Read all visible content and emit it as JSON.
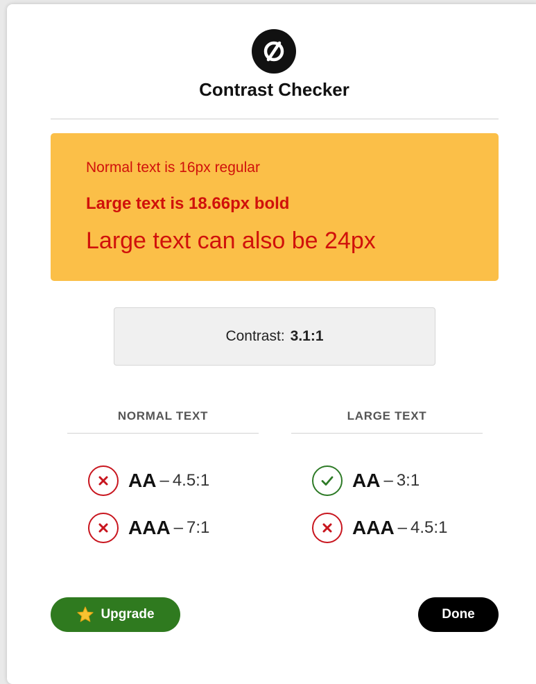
{
  "dialog": {
    "title": "Contrast Checker",
    "logo_icon": "no-entry-slash-icon"
  },
  "sample": {
    "background_color": "#fbbf48",
    "text_color": "#d0110b",
    "normal_text": "Normal text is 16px regular",
    "bold_text": "Large text is 18.66px bold",
    "large_text": "Large text can also be 24px"
  },
  "contrast": {
    "label": "Contrast:",
    "ratio": "3.1:1"
  },
  "results": {
    "normal": {
      "header": "NORMAL TEXT",
      "items": [
        {
          "level": "AA",
          "separator": "–",
          "requirement": "4.5:1",
          "pass": false,
          "icon": "x-circle-icon"
        },
        {
          "level": "AAA",
          "separator": "–",
          "requirement": "7:1",
          "pass": false,
          "icon": "x-circle-icon"
        }
      ]
    },
    "large": {
      "header": "LARGE TEXT",
      "items": [
        {
          "level": "AA",
          "separator": "–",
          "requirement": "3:1",
          "pass": true,
          "icon": "check-circle-icon"
        },
        {
          "level": "AAA",
          "separator": "–",
          "requirement": "4.5:1",
          "pass": false,
          "icon": "x-circle-icon"
        }
      ]
    }
  },
  "colors": {
    "fail": "#c8151e",
    "pass": "#2d7a26",
    "upgrade_button": "#2f7a1f",
    "done_button": "#000000"
  },
  "buttons": {
    "upgrade_label": "Upgrade",
    "upgrade_icon": "star-icon",
    "done_label": "Done"
  }
}
